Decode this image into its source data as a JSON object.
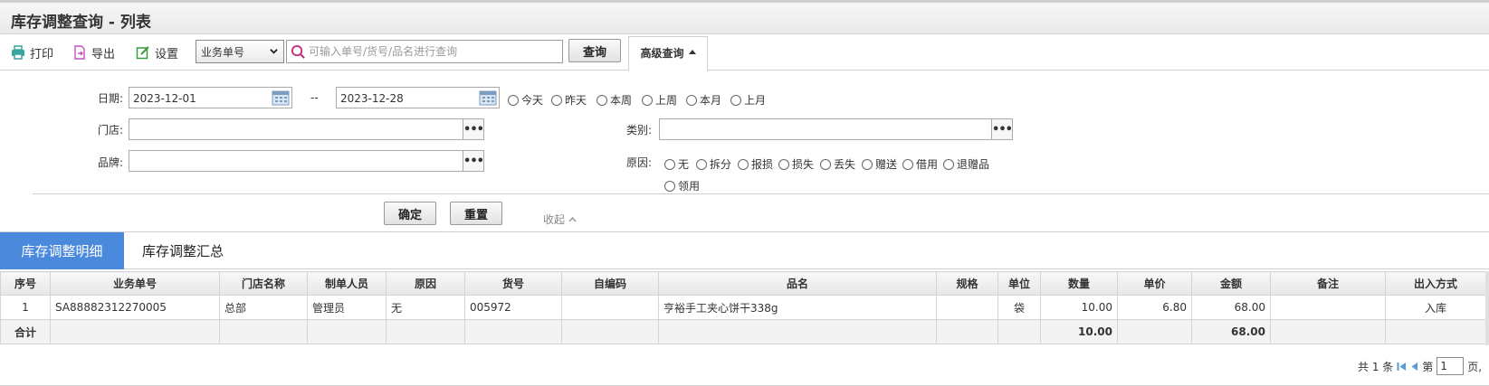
{
  "page": {
    "title": "库存调整查询 - 列表"
  },
  "toolbar": {
    "print_label": "打印",
    "export_label": "导出",
    "settings_label": "设置",
    "search_type_selected": "业务单号",
    "search_placeholder": "可输入单号/货号/品名进行查询",
    "query_label": "查询",
    "advanced_label": "高级查询"
  },
  "filters": {
    "date_label": "日期:",
    "date_from": "2023-12-01",
    "date_sep": "--",
    "date_to": "2023-12-28",
    "date_quick": [
      "今天",
      "昨天",
      "本周",
      "上周",
      "本月",
      "上月"
    ],
    "store_label": "门店:",
    "category_label": "类别:",
    "brand_label": "品牌:",
    "reason_label": "原因:",
    "reasons": [
      "无",
      "拆分",
      "报损",
      "损失",
      "丢失",
      "赠送",
      "借用",
      "退赠品",
      "领用"
    ],
    "confirm_label": "确定",
    "reset_label": "重置",
    "collapse_label": "收起"
  },
  "tabs": {
    "detail": "库存调整明细",
    "summary": "库存调整汇总"
  },
  "table": {
    "headers": [
      "序号",
      "业务单号",
      "门店名称",
      "制单人员",
      "原因",
      "货号",
      "自编码",
      "品名",
      "规格",
      "单位",
      "数量",
      "单价",
      "金额",
      "备注",
      "出入方式"
    ],
    "rows": [
      [
        "1",
        "SA88882312270005",
        "总部",
        "管理员",
        "无",
        "005972",
        "",
        "亨裕手工夹心饼干338g",
        "",
        "袋",
        "10.00",
        "6.80",
        "68.00",
        "",
        "入库"
      ]
    ],
    "total": {
      "label": "合计",
      "qty": "10.00",
      "amount": "68.00"
    }
  },
  "pager": {
    "total_text": "共 1 条",
    "page_prefix": "第",
    "page_value": "1",
    "page_suffix": "页,"
  },
  "colors": {
    "accent": "#4a89dc",
    "print_icon": "#3aa6a0",
    "export_icon": "#c050c0",
    "settings_icon": "#3b9a3b",
    "search_icon": "#c0307a"
  }
}
